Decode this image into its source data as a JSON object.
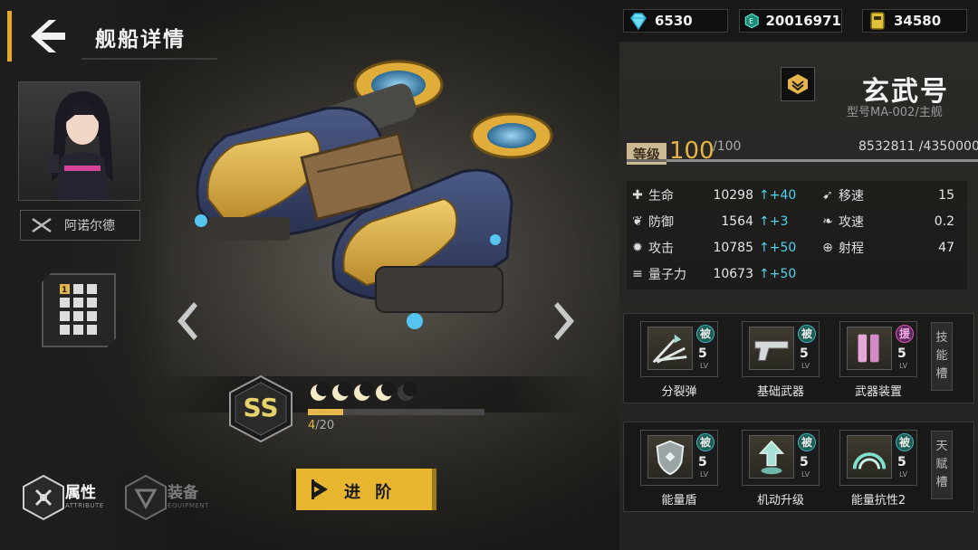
{
  "header": {
    "title": "舰船详情"
  },
  "currencies": [
    {
      "icon": "diamond-icon",
      "value": "6530"
    },
    {
      "icon": "credit-coin-icon",
      "value": "20016971"
    },
    {
      "icon": "supply-card-icon",
      "value": "34580"
    }
  ],
  "pilot": {
    "name": "阿诺尔德"
  },
  "formation": {
    "badge": "1"
  },
  "rank": {
    "grade": "SS",
    "stars_filled": 4,
    "stars_total": 5,
    "progress_current": 4,
    "progress_max": 20,
    "progress_text_current": "4",
    "progress_text_max": "/20"
  },
  "tabs": [
    {
      "label": "属性",
      "sub": "ATTRIBUTE",
      "active": true
    },
    {
      "label": "装备",
      "sub": "EQUIPMENT",
      "active": false
    }
  ],
  "advance_button": "进 阶",
  "ship": {
    "name": "玄武号",
    "model": "型号MA-002/主舰",
    "level_label": "等级",
    "level": "100",
    "level_max": "/100",
    "exp": "8532811 /4350000"
  },
  "stats": [
    {
      "icon": "plus-icon",
      "label": "生命",
      "value": "10298",
      "bonus": "↑+40"
    },
    {
      "icon": "shield-heart-icon",
      "label": "防御",
      "value": "1564",
      "bonus": "↑+3"
    },
    {
      "icon": "attack-burst-icon",
      "label": "攻击",
      "value": "10785",
      "bonus": "↑+50"
    },
    {
      "icon": "quantum-bars-icon",
      "label": "量子力",
      "value": "10673",
      "bonus": "↑+50"
    },
    {
      "icon": "speed-boot-icon",
      "label": "移速",
      "value": "15",
      "bonus": ""
    },
    {
      "icon": "feather-icon",
      "label": "攻速",
      "value": "0.2",
      "bonus": ""
    },
    {
      "icon": "crosshair-icon",
      "label": "射程",
      "value": "47",
      "bonus": ""
    }
  ],
  "skill_slot_label": [
    "技",
    "能",
    "槽"
  ],
  "talent_slot_label": [
    "天",
    "赋",
    "槽"
  ],
  "skills": [
    {
      "name": "分裂弹",
      "tag": "被",
      "level": "5",
      "lv_text": "LV",
      "icon": "split-bullet-icon"
    },
    {
      "name": "基础武器",
      "tag": "被",
      "level": "5",
      "lv_text": "LV",
      "icon": "pistol-icon"
    },
    {
      "name": "武器装置",
      "tag": "援",
      "level": "5",
      "lv_text": "LV",
      "icon": "weapon-device-icon"
    }
  ],
  "talents": [
    {
      "name": "能量盾",
      "tag": "被",
      "level": "5",
      "lv_text": "LV",
      "icon": "energy-shield-icon"
    },
    {
      "name": "机动升级",
      "tag": "被",
      "level": "5",
      "lv_text": "LV",
      "icon": "mobility-upgrade-icon"
    },
    {
      "name": "能量抗性2",
      "tag": "被",
      "level": "5",
      "lv_text": "LV",
      "icon": "energy-resist-icon"
    }
  ],
  "colors": {
    "accent": "#e8b52f",
    "bonus": "#4fd4ef",
    "panel": "#2b2a27"
  }
}
